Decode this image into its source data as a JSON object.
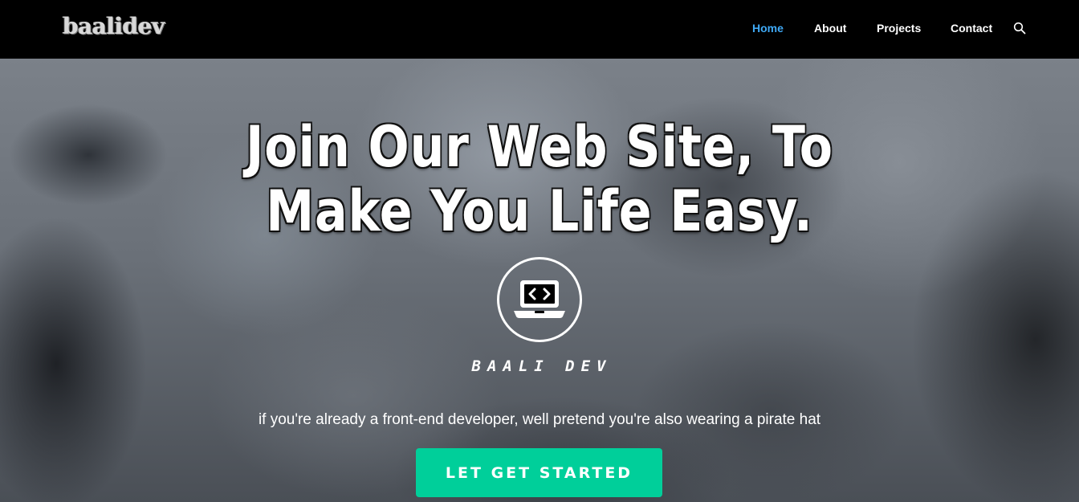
{
  "navbar": {
    "logo": "baalidev",
    "links": [
      {
        "label": "Home",
        "active": true
      },
      {
        "label": "About",
        "active": false
      },
      {
        "label": "Projects",
        "active": false
      },
      {
        "label": "Contact",
        "active": false
      }
    ],
    "search_icon": "search-icon",
    "active_color": "#3fa9f5"
  },
  "hero": {
    "title_line1": "Join Our Web Site, To",
    "title_line2": "Make You Life Easy.",
    "emblem_icon": "laptop-code-icon",
    "brand_name": "BAALI DEV",
    "tagline": "if you're already a front-end developer, well pretend you're also wearing a pirate hat",
    "cta_label": "LET GET STARTED",
    "cta_color": "#00cf9a"
  }
}
